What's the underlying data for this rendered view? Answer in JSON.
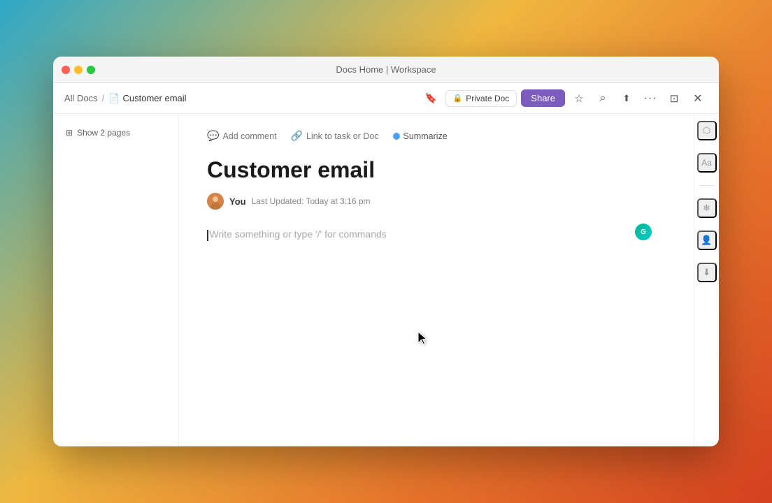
{
  "window": {
    "title": "Docs Home | Workspace"
  },
  "titlebar": {
    "title": "Docs Home | Workspace"
  },
  "breadcrumb": {
    "home": "All Docs",
    "separator": "/",
    "current": "Customer email"
  },
  "toolbar": {
    "private_doc_label": "Private Doc",
    "share_label": "Share"
  },
  "sidebar": {
    "show_pages_label": "Show 2 pages"
  },
  "actions": {
    "add_comment": "Add comment",
    "link_task": "Link to task or Doc",
    "summarize": "Summarize"
  },
  "document": {
    "title": "Customer email",
    "author": "You",
    "last_updated_label": "Last Updated:",
    "last_updated_value": "Today at 3:16 pm",
    "placeholder": "Write something or type '/' for commands"
  },
  "ai_avatar": {
    "label": "G"
  },
  "icons": {
    "lock": "🔒",
    "star": "☆",
    "search": "⌕",
    "export": "⬆",
    "more": "···",
    "minimize": "—",
    "close": "✕",
    "comment": "💬",
    "link": "🔗",
    "font": "Aa",
    "snowflake": "❄",
    "person": "👤",
    "download": "⬇"
  }
}
